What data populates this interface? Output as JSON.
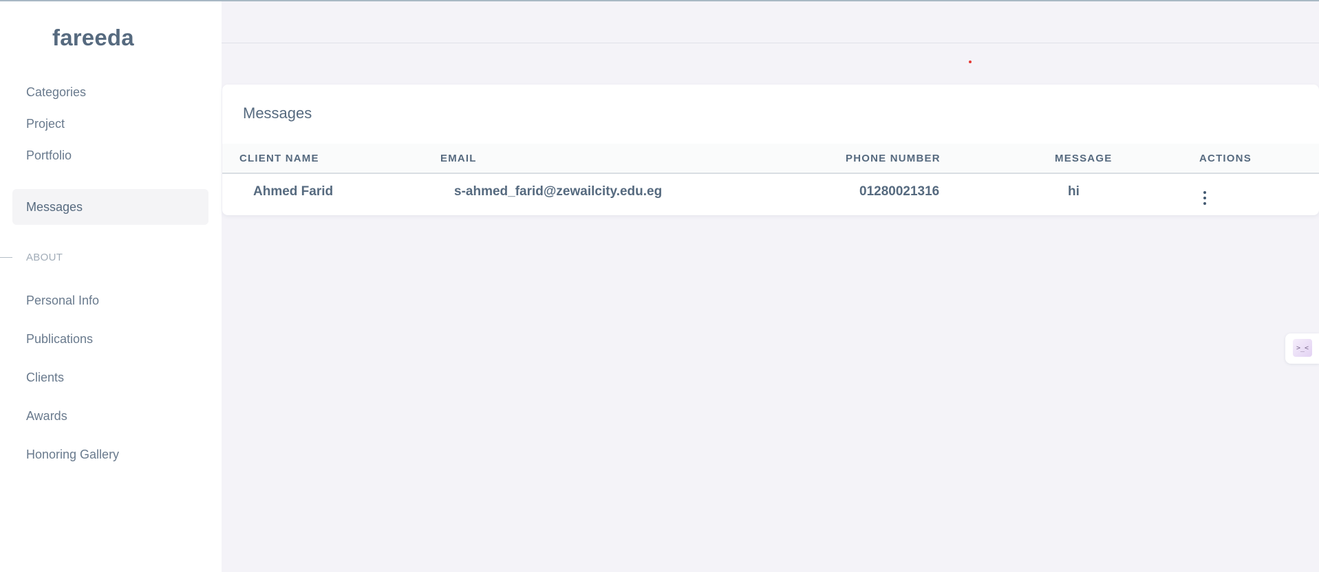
{
  "brand": {
    "name": "fareeda"
  },
  "sidebar": {
    "items": [
      {
        "label": "Categories"
      },
      {
        "label": "Project"
      },
      {
        "label": "Portfolio"
      },
      {
        "label": "Messages",
        "active": true
      }
    ],
    "section_header": "ABOUT",
    "about_items": [
      {
        "label": "Personal Info"
      },
      {
        "label": "Publications"
      },
      {
        "label": "Clients"
      },
      {
        "label": "Awards"
      },
      {
        "label": "Honoring Gallery"
      }
    ]
  },
  "card": {
    "title": "Messages",
    "columns": [
      "CLIENT NAME",
      "EMAIL",
      "PHONE NUMBER",
      "MESSAGE",
      "ACTIONS"
    ],
    "rows": [
      {
        "client_name": "Ahmed Farid",
        "email": "s-ahmed_farid@zewailcity.edu.eg",
        "phone": "01280021316",
        "message": "hi"
      }
    ]
  },
  "icons": {
    "actions": "more-vertical-icon",
    "widget": "customizer-icon",
    "widget_glyph": ">_<"
  },
  "colors": {
    "sidebar_bg": "#ffffff",
    "page_bg": "#f4f3f8",
    "text_primary": "#566a7f",
    "active_item_bg": "#f4f4f6",
    "notification_dot": "#e53935"
  }
}
